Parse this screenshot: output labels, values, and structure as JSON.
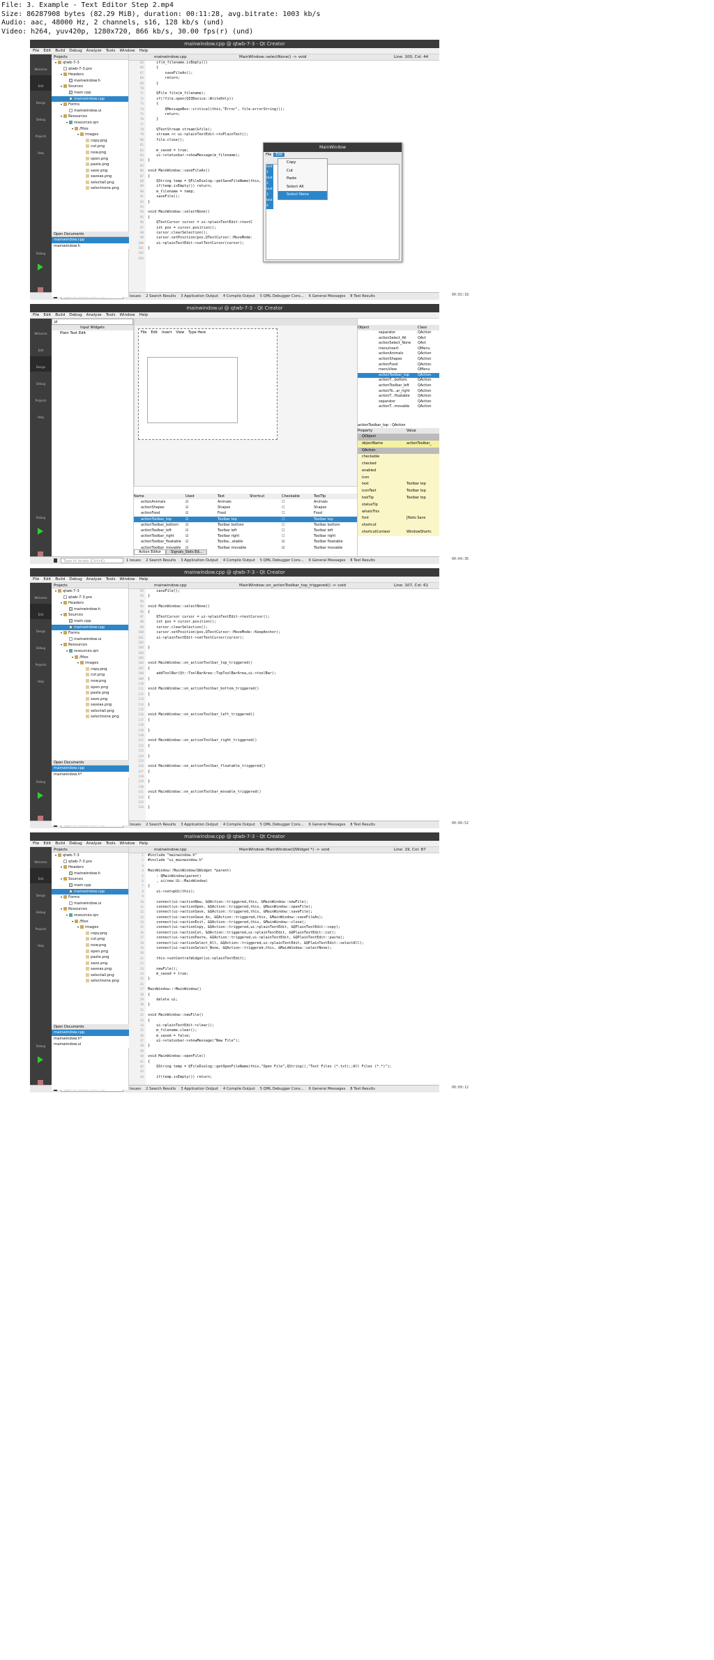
{
  "header": {
    "lines": [
      "File: 3. Example - Text Editor Step 2.mp4",
      "Size: 86287908 bytes (82.29 MiB), duration: 00:11:28, avg.bitrate: 1003 kb/s",
      "Audio: aac, 48000 Hz, 2 channels, s16, 128 kb/s (und)",
      "Video: h264, yuv420p, 1280x720, 866 kb/s, 30.00 fps(r) (und)"
    ]
  },
  "menu": [
    "File",
    "Edit",
    "Build",
    "Debug",
    "Analyze",
    "Tools",
    "Window",
    "Help"
  ],
  "modes": [
    "Welcome",
    "Edit",
    "Design",
    "Debug",
    "Projects",
    "Help"
  ],
  "runlabel": "Debug",
  "projtree": [
    {
      "d": 0,
      "t": "qtwb-7-3",
      "k": "fold",
      "ar": "▾"
    },
    {
      "d": 1,
      "t": "qtwb-7-3.pro",
      "k": "file"
    },
    {
      "d": 1,
      "t": "Headers",
      "k": "fold",
      "ar": "▾"
    },
    {
      "d": 2,
      "t": "mainwindow.h",
      "k": "cpp"
    },
    {
      "d": 1,
      "t": "Sources",
      "k": "fold",
      "ar": "▾"
    },
    {
      "d": 2,
      "t": "main.cpp",
      "k": "cpp"
    },
    {
      "d": 2,
      "t": "mainwindow.cpp",
      "k": "cpp",
      "s": 1
    },
    {
      "d": 1,
      "t": "Forms",
      "k": "fold",
      "ar": "▾"
    },
    {
      "d": 2,
      "t": "mainwindow.ui",
      "k": "file"
    },
    {
      "d": 1,
      "t": "Resources",
      "k": "fold",
      "ar": "▾"
    },
    {
      "d": 2,
      "t": "resources.qrc",
      "k": "qrc",
      "ar": "▾"
    },
    {
      "d": 3,
      "t": "/files",
      "k": "fold",
      "ar": "▾"
    },
    {
      "d": 4,
      "t": "images",
      "k": "fold",
      "ar": "▾"
    },
    {
      "d": 5,
      "t": "copy.png",
      "k": "img"
    },
    {
      "d": 5,
      "t": "cut.png",
      "k": "img"
    },
    {
      "d": 5,
      "t": "new.png",
      "k": "img"
    },
    {
      "d": 5,
      "t": "open.png",
      "k": "img"
    },
    {
      "d": 5,
      "t": "paste.png",
      "k": "img"
    },
    {
      "d": 5,
      "t": "save.png",
      "k": "img"
    },
    {
      "d": 5,
      "t": "saveas.png",
      "k": "img"
    },
    {
      "d": 5,
      "t": "selectall.png",
      "k": "img"
    },
    {
      "d": 5,
      "t": "selectnone.png",
      "k": "img"
    }
  ],
  "panes": [
    {
      "title": "mainwindow.cpp @ qtwb-7-3 - Qt Creator",
      "file": "mainwindow.cpp",
      "func": "MainWindow::selectNone() -> void",
      "pos": "Line: 100, Col: 44",
      "ts": "00:02:18",
      "docs": [
        "mainwindow.cpp",
        "mainwindow.h"
      ],
      "doctitle": "Open Documents",
      "start": 65,
      "code": [
        "    if(m_filename.isEmpty())",
        "    {",
        "        saveFileAs();",
        "        return;",
        "    }",
        "",
        "    QFile file(m_filename);",
        "    if(!file.open(QIODevice::WriteOnly))",
        "    {",
        "        QMessageBox::critical(this,\"Error\", file.errorString());",
        "        return;",
        "    }",
        "",
        "    QTextStream stream(&file);",
        "    stream << ui->plainTextEdit->toPlainText();",
        "    file.close();",
        "",
        "    m_saved = true;",
        "    ui->statusbar->showMessage(m_filename);",
        "}",
        "",
        "void MainWindow::saveFileAs()",
        "{",
        "    QString temp = QFileDialog::getSaveFileName(this,",
        "    if(temp.isEmpty()) return;",
        "    m_filename = temp;",
        "    saveFile();",
        "}",
        "",
        "void MainWindow::selectNone()",
        "{",
        "    QTextCursor cursor = ui->plainTextEdit->textC",
        "    int pos = cursor.position();",
        "    cursor.clearSelection();",
        "    cursor.setPosition(pos,QTextCursor::MoveMode:",
        "    ui->plainTextEdit->setTextCursor(cursor);",
        "}",
        "",
        ""
      ],
      "dialog": {
        "title": "MainWindow",
        "menu": [
          "File",
          "Edit"
        ],
        "items": [
          "Copy",
          "Cut",
          "Paste",
          "Select All",
          "Select None"
        ],
        "text": [
          "test 1",
          "test 2",
          "test 3",
          "test 4"
        ]
      }
    },
    {
      "title": "mainwindow.ui @ qtwb-7-3 - Qt Creator",
      "ts": "00:04:36",
      "file": "mainwindow.ui",
      "filter": "pl",
      "widgetbox": "Input Widgets",
      "widget": "Plain Text Edit",
      "formmenu": [
        "File",
        "Edit",
        "Insert",
        "View",
        "Type Here"
      ],
      "objhdr": [
        "Object",
        "Class"
      ],
      "objs": [
        [
          "separator",
          "QAction"
        ],
        [
          "actionSelect_All",
          "QAct"
        ],
        [
          "actionSelect_None",
          "QAct"
        ],
        [
          "menuInsert",
          "QMenu"
        ],
        [
          "actionAnimals",
          "QAction"
        ],
        [
          "actionShapes",
          "QAction"
        ],
        [
          "actionFood",
          "QAction"
        ],
        [
          "menuView",
          "QMenu"
        ],
        [
          "actionToolbar_top",
          "QAction"
        ],
        [
          "actionT...bottom",
          "QAction"
        ],
        [
          "actionToolbar_left",
          "QAction"
        ],
        [
          "actionTo...ar_right",
          "QAction"
        ],
        [
          "actionT...floatable",
          "QAction"
        ],
        [
          "separator",
          "QAction"
        ],
        [
          "actionT...movable",
          "QAction"
        ]
      ],
      "filterlabel": "Filter",
      "propcaption": "actionToolbar_top : QAction",
      "prophdr": [
        "Property",
        "Value"
      ],
      "props": [
        [
          "QObject",
          ""
        ],
        [
          "objectName",
          "actionToolbar_"
        ],
        [
          "QAction",
          ""
        ],
        [
          "checkable",
          ""
        ],
        [
          "checked",
          ""
        ],
        [
          "enabled",
          ""
        ],
        [
          "icon",
          ""
        ],
        [
          "text",
          "Toolbar top"
        ],
        [
          "iconText",
          "Toolbar top"
        ],
        [
          "toolTip",
          "Toolbar top"
        ],
        [
          "statusTip",
          ""
        ],
        [
          "whatsThis",
          ""
        ],
        [
          "font",
          "[Noto Sans"
        ],
        [
          "shortcut",
          ""
        ],
        [
          "shortcutContext",
          "WindowShortc"
        ]
      ],
      "acthdr": [
        "Name",
        "Used",
        "Text",
        "Shortcut",
        "Checkable",
        "ToolTip"
      ],
      "acts": [
        [
          "actionAnimals",
          "Animals",
          "Animals",
          0
        ],
        [
          "actionShapes",
          "Shapes",
          "Shapes",
          0
        ],
        [
          "actionFood",
          "Food",
          "Food",
          0
        ],
        [
          "actionToolbar_top",
          "Toolbar top",
          "Toolbar top",
          0
        ],
        [
          "actionToolbar_bottom",
          "Toolbar bottom",
          "Toolbar bottom",
          0
        ],
        [
          "actionToolbar_left",
          "Toolbar left",
          "Toolbar left",
          0
        ],
        [
          "actionToolbar_right",
          "Toolbar right",
          "Toolbar right",
          0
        ],
        [
          "actionToolbar_floatable",
          "Toolba...atable",
          "Toolbar floatable",
          1
        ],
        [
          "actionToolbar_movable",
          "Toolbar movable",
          "Toolbar movable",
          1
        ]
      ],
      "tabs": [
        "Action Editor",
        "Signals_Slots Ed..."
      ]
    },
    {
      "title": "mainwindow.cpp @ qtwb-7-3 - Qt Creator",
      "file": "mainwindow.cpp",
      "func": "MainWindow::on_actionToolbar_top_triggered() -> void",
      "pos": "Line: 107, Col: 61",
      "ts": "00:06:52",
      "docs": [
        "mainwindow.cpp",
        "mainwindow.h*"
      ],
      "doctitle": "Open Documents",
      "start": 92,
      "code": [
        "    saveFile();",
        "}",
        "",
        "void MainWindow::selectNone()",
        "{",
        "    QTextCursor cursor = ui->plainTextEdit->textCursor();",
        "    int pos = cursor.position();",
        "    cursor.clearSelection();",
        "    cursor.setPosition(pos,QTextCursor::MoveMode::KeepAnchor);",
        "    ui->plainTextEdit->setTextCursor(cursor);",
        "",
        "}",
        "",
        "",
        "void MainWindow::on_actionToolbar_top_triggered()",
        "{",
        "    addToolBar(Qt::ToolBarArea::TopToolBarArea,ui->toolBar);",
        "}",
        "",
        "void MainWindow::on_actionToolbar_bottom_triggered()",
        "{",
        "",
        "}",
        "",
        "void MainWindow::on_actionToolbar_left_triggered()",
        "{",
        "",
        "}",
        "",
        "void MainWindow::on_actionToolbar_right_triggered()",
        "{",
        "",
        "}",
        "",
        "void MainWindow::on_actionToolbar_floatable_triggered()",
        "{",
        "",
        "}",
        "",
        "void MainWindow::on_actionToolbar_movable_triggered()",
        "{",
        "",
        "}"
      ]
    },
    {
      "title": "mainwindow.cpp @ qtwb-7-3 - Qt Creator",
      "file": "mainwindow.cpp",
      "func": "MainWindow::MainWindow(QWidget *) -> void",
      "pos": "Line: 19, Col: 87",
      "ts": "00:09:12",
      "docs": [
        "mainwindow.cpp",
        "mainwindow.h*",
        "mainwindow.ui"
      ],
      "doctitle": "Open Documents",
      "start": 1,
      "code": [
        "#include \"mainwindow.h\"",
        "#include \"ui_mainwindow.h\"",
        "",
        "MainWindow::MainWindow(QWidget *parent)",
        "    : QMainWindow(parent)",
        "    , ui(new Ui::MainWindow)",
        "{",
        "    ui->setupUi(this);",
        "",
        "    connect(ui->actionNew, &QAction::triggered,this, &MainWindow::newFile);",
        "    connect(ui->actionOpen, &QAction::triggered,this, &MainWindow::openFile);",
        "    connect(ui->actionSave, &QAction::triggered,this, &MainWindow::saveFile);",
        "    connect(ui->actionSave_As, &QAction::triggered,this, &MainWindow::saveFileAs);",
        "    connect(ui->actionExit, &QAction::triggered,this, &MainWindow::close);",
        "    connect(ui->actionCopy, &QAction::triggered,ui->plainTextEdit, &QPlainTextEdit::copy);",
        "    connect(ui->actionCut, &QAction::triggered,ui->plainTextEdit, &QPlainTextEdit::cut);",
        "    connect(ui->actionPaste, &QAction::triggered,ui->plainTextEdit, &QPlainTextEdit::paste);",
        "    connect(ui->actionSelect_All, &QAction::triggered,ui->plainTextEdit, &QPlainTextEdit::selectAll);",
        "    connect(ui->actionSelect_None, &QAction::triggered,this, &MainWindow::selectNone);",
        "",
        "    this->setCentralWidget(ui->plainTextEdit);",
        "",
        "    newFile();",
        "    m_saved = true;",
        "}",
        "",
        "MainWindow::~MainWindow()",
        "{",
        "    delete ui;",
        "}",
        "",
        "void MainWindow::newFile()",
        "{",
        "    ui->plainTextEdit->clear();",
        "    m_filename.clear();",
        "    m_saved = false;",
        "    ui->statusbar->showMessage(\"New File\");",
        "}",
        "",
        "void MainWindow::openFile()",
        "{",
        "    QString temp = QFileDialog::getOpenFileName(this,\"Open File\",QString(),\"Text Files (*.txt);;All Files (*.*)\");",
        "",
        "    if(temp.isEmpty()) return;"
      ]
    }
  ],
  "projtitle": "Projects",
  "status": {
    "locate": "Type to locate (Ctrl+K)",
    "items": [
      "1 Issues",
      "2 Search Results",
      "3 Application Output",
      "4 Compile Output",
      "5 QML Debugger Cons...",
      "6 General Messages",
      "8 Test Results"
    ]
  },
  "colors": {
    "selection": "#2d86c9",
    "sidebar": "#3d3d3d",
    "titlebar": "#3a3a3a"
  }
}
